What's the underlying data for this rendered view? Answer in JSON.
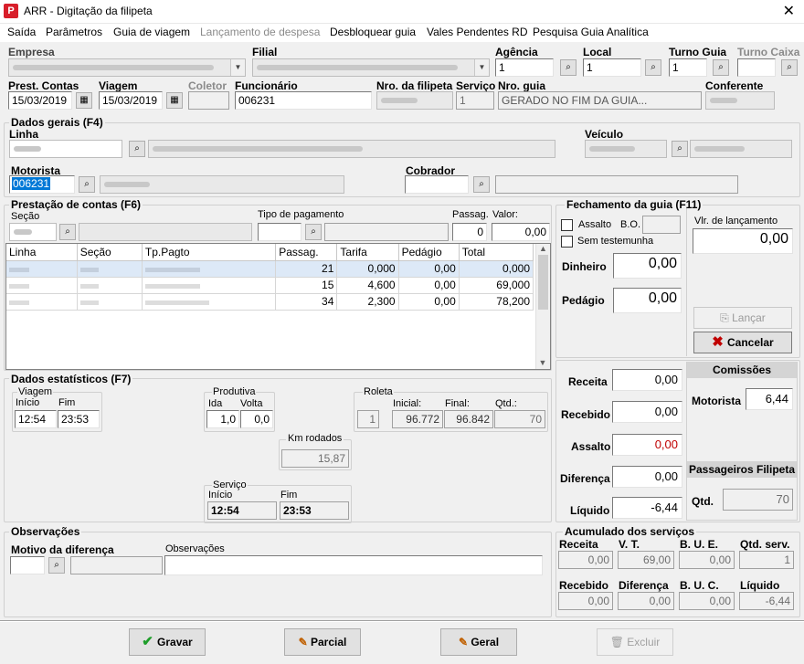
{
  "window": {
    "title": "ARR - Digitação da filipeta",
    "close": "✕",
    "app_icon": "P"
  },
  "menu": [
    "Saída",
    "Parâmetros",
    "Guia de viagem",
    "Lançamento de despesa",
    "Desbloquear guia",
    "Vales Pendentes RD",
    "Pesquisa Guia Analítica"
  ],
  "header": {
    "empresa_label": "Empresa",
    "filial_label": "Filial",
    "agencia_label": "Agência",
    "agencia_value": "1",
    "local_label": "Local",
    "local_value": "1",
    "turno_guia_label": "Turno Guia",
    "turno_guia_value": "1",
    "turno_caixa_label": "Turno Caixa",
    "prest_contas_label": "Prest. Contas",
    "prest_contas_value": "15/03/2019",
    "viagem_label": "Viagem",
    "viagem_value": "15/03/2019",
    "coletor_label": "Coletor",
    "funcionario_label": "Funcionário",
    "funcionario_value": "006231",
    "nro_filipeta_label": "Nro. da filipeta",
    "servico_label": "Serviço",
    "servico_value": "1",
    "nro_guia_label": "Nro. guia",
    "nro_guia_value": "GERADO NO FIM DA GUIA...",
    "conferente_label": "Conferente"
  },
  "dados_gerais": {
    "title": "Dados gerais (F4)",
    "linha_label": "Linha",
    "veiculo_label": "Veículo",
    "motorista_label": "Motorista",
    "motorista_value": "006231",
    "cobrador_label": "Cobrador"
  },
  "prestacao": {
    "title": "Prestação de contas (F6)",
    "secao_label": "Seção",
    "tipo_pagamento_label": "Tipo de pagamento",
    "passag_label": "Passag.",
    "passag_value": "0",
    "valor_label": "Valor:",
    "valor_value": "0,00",
    "columns": [
      "Linha",
      "Seção",
      "Tp.Pagto",
      "Passag.",
      "Tarifa",
      "Pedágio",
      "Total"
    ],
    "rows": [
      {
        "passag": "21",
        "tarifa": "0,000",
        "pedagio": "0,00",
        "total": "0,000"
      },
      {
        "passag": "15",
        "tarifa": "4,600",
        "pedagio": "0,00",
        "total": "69,000"
      },
      {
        "passag": "34",
        "tarifa": "2,300",
        "pedagio": "0,00",
        "total": "78,200"
      }
    ]
  },
  "fechamento": {
    "title": "Fechamento da guia (F11)",
    "assalto_label": "Assalto",
    "bo_label": "B.O.",
    "sem_testemunha_label": "Sem testemunha",
    "dinheiro_label": "Dinheiro",
    "dinheiro_value": "0,00",
    "pedagio_label": "Pedágio",
    "pedagio_value": "0,00",
    "vlr_lancamento_label": "Vlr. de lançamento",
    "vlr_lancamento_value": "0,00",
    "lancar_label": "Lançar",
    "cancelar_label": "Cancelar",
    "receita_label": "Receita",
    "receita_value": "0,00",
    "recebido_label": "Recebido",
    "recebido_value": "0,00",
    "assalto2_label": "Assalto",
    "assalto2_value": "0,00",
    "diferenca_label": "Diferença",
    "diferenca_value": "0,00",
    "liquido_label": "Líquido",
    "liquido_value": "-6,44",
    "comissoes_title": "Comissões",
    "motorista_label": "Motorista",
    "motorista_value": "6,44",
    "passageiros_title": "Passageiros Filipeta",
    "qtd_label": "Qtd.",
    "qtd_value": "70"
  },
  "estatisticos": {
    "title": "Dados estatísticos (F7)",
    "viagem_title": "Viagem",
    "inicio_label": "Início",
    "inicio_value": "12:54",
    "fim_label": "Fim",
    "fim_value": "23:53",
    "produtiva_title": "Produtiva",
    "ida_label": "Ida",
    "ida_value": "1,0",
    "volta_label": "Volta",
    "volta_value": "0,0",
    "roleta_title": "Roleta",
    "roleta_num": "1",
    "inicial_label": "Inicial:",
    "inicial_value": "96.772",
    "final_label": "Final:",
    "final_value": "96.842",
    "qtd_label": "Qtd.:",
    "qtd_value": "70",
    "km_label": "Km rodados",
    "km_value": "15,87",
    "servico_title": "Serviço",
    "s_inicio_label": "Início",
    "s_inicio_value": "12:54",
    "s_fim_label": "Fim",
    "s_fim_value": "23:53"
  },
  "observacoes": {
    "title": "Observações",
    "motivo_label": "Motivo da diferença",
    "obs_label": "Observações"
  },
  "acumulado": {
    "title": "Acumulado dos serviços",
    "receita_label": "Receita",
    "receita_value": "0,00",
    "vt_label": "V. T.",
    "vt_value": "69,00",
    "bue_label": "B. U. E.",
    "bue_value": "0,00",
    "qtd_serv_label": "Qtd. serv.",
    "qtd_serv_value": "1",
    "recebido_label": "Recebido",
    "recebido_value": "0,00",
    "diferenca_label": "Diferença",
    "diferenca_value": "0,00",
    "buc_label": "B. U. C.",
    "buc_value": "0,00",
    "liquido_label": "Líquido",
    "liquido_value": "-6,44"
  },
  "buttons": {
    "gravar": "Gravar",
    "parcial": "Parcial",
    "geral": "Geral",
    "excluir": "Excluir"
  },
  "colors": {
    "accent_red": "#c00000",
    "check_green": "#1e9e2a",
    "selection_blue": "#0078d7"
  }
}
